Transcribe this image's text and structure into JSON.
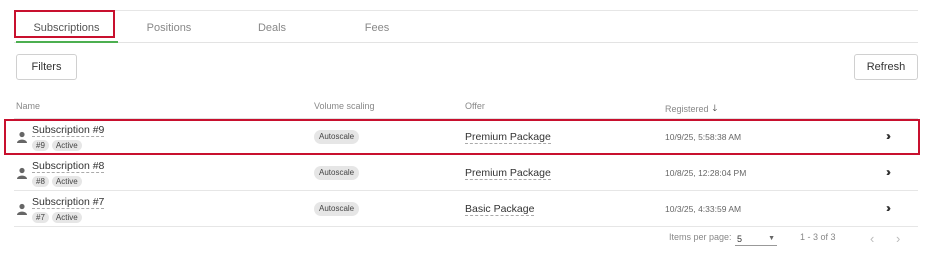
{
  "tabs": [
    {
      "label": "Subscriptions"
    },
    {
      "label": "Positions"
    },
    {
      "label": "Deals"
    },
    {
      "label": "Fees"
    }
  ],
  "toolbar": {
    "filters_label": "Filters",
    "refresh_label": "Refresh"
  },
  "columns": {
    "name": "Name",
    "volume": "Volume scaling",
    "offer": "Offer",
    "registered": "Registered"
  },
  "rows": [
    {
      "name": "Subscription #9",
      "id_tag": "#9",
      "status": "Active",
      "volume": "Autoscale",
      "offer": "Premium Package",
      "registered": "10/9/25, 5:58:38 AM"
    },
    {
      "name": "Subscription #8",
      "id_tag": "#8",
      "status": "Active",
      "volume": "Autoscale",
      "offer": "Premium Package",
      "registered": "10/8/25, 12:28:04 PM"
    },
    {
      "name": "Subscription #7",
      "id_tag": "#7",
      "status": "Active",
      "volume": "Autoscale",
      "offer": "Basic Package",
      "registered": "10/3/25, 4:33:59 AM"
    }
  ],
  "pagination": {
    "items_per_page_label": "Items per page:",
    "items_per_page": "5",
    "range": "1 - 3 of 3"
  },
  "colors": {
    "accent": "#4caf50",
    "highlight": "#c8102e"
  },
  "icons": {
    "avatar": "user-icon",
    "row_open": "double-chevron-right-icon",
    "sort": "arrow-down-icon"
  }
}
